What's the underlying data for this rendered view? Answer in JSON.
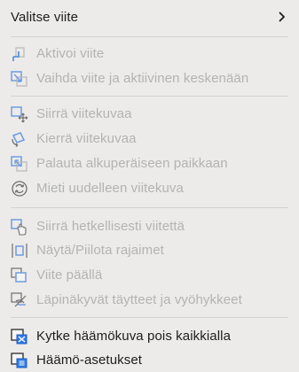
{
  "menu": {
    "header": {
      "label": "Valitse viite",
      "icon": "chevron-right-icon"
    },
    "group1": [
      {
        "label": "Aktivoi viite",
        "icon": "activate-reference-icon",
        "enabled": false
      },
      {
        "label": "Vaihda viite ja aktiivinen keskenään",
        "icon": "swap-reference-icon",
        "enabled": false
      }
    ],
    "group2": [
      {
        "label": "Siirrä viitekuvaa",
        "icon": "move-reference-image-icon",
        "enabled": false
      },
      {
        "label": "Kierrä viitekuvaa",
        "icon": "rotate-reference-image-icon",
        "enabled": false
      },
      {
        "label": "Palauta alkuperäiseen paikkaan",
        "icon": "reset-position-icon",
        "enabled": false
      },
      {
        "label": "Mieti uudelleen viitekuva",
        "icon": "refresh-reference-icon",
        "enabled": false
      }
    ],
    "group3": [
      {
        "label": "Siirrä hetkellisesti viitettä",
        "icon": "temporary-move-hand-icon",
        "enabled": false
      },
      {
        "label": "Näytä/Piilota rajaimet",
        "icon": "show-hide-bounds-icon",
        "enabled": false
      },
      {
        "label": "Viite päällä",
        "icon": "reference-on-top-icon",
        "enabled": false
      },
      {
        "label": "Läpinäkyvät täytteet ja vyöhykkeet",
        "icon": "transparent-fills-icon",
        "enabled": false
      }
    ],
    "group4": [
      {
        "label": "Kytke häämökuva pois kaikkialla",
        "icon": "ghost-off-everywhere-icon",
        "enabled": true
      },
      {
        "label": "Häämö-asetukset",
        "icon": "ghost-settings-icon",
        "enabled": true
      }
    ],
    "colors": {
      "background": "#ecebea",
      "text_enabled": "#1d1d1d",
      "text_disabled": "#b3b3b3",
      "icon_accent": "#2f7ae5",
      "separator": "#d3d2d1"
    }
  }
}
